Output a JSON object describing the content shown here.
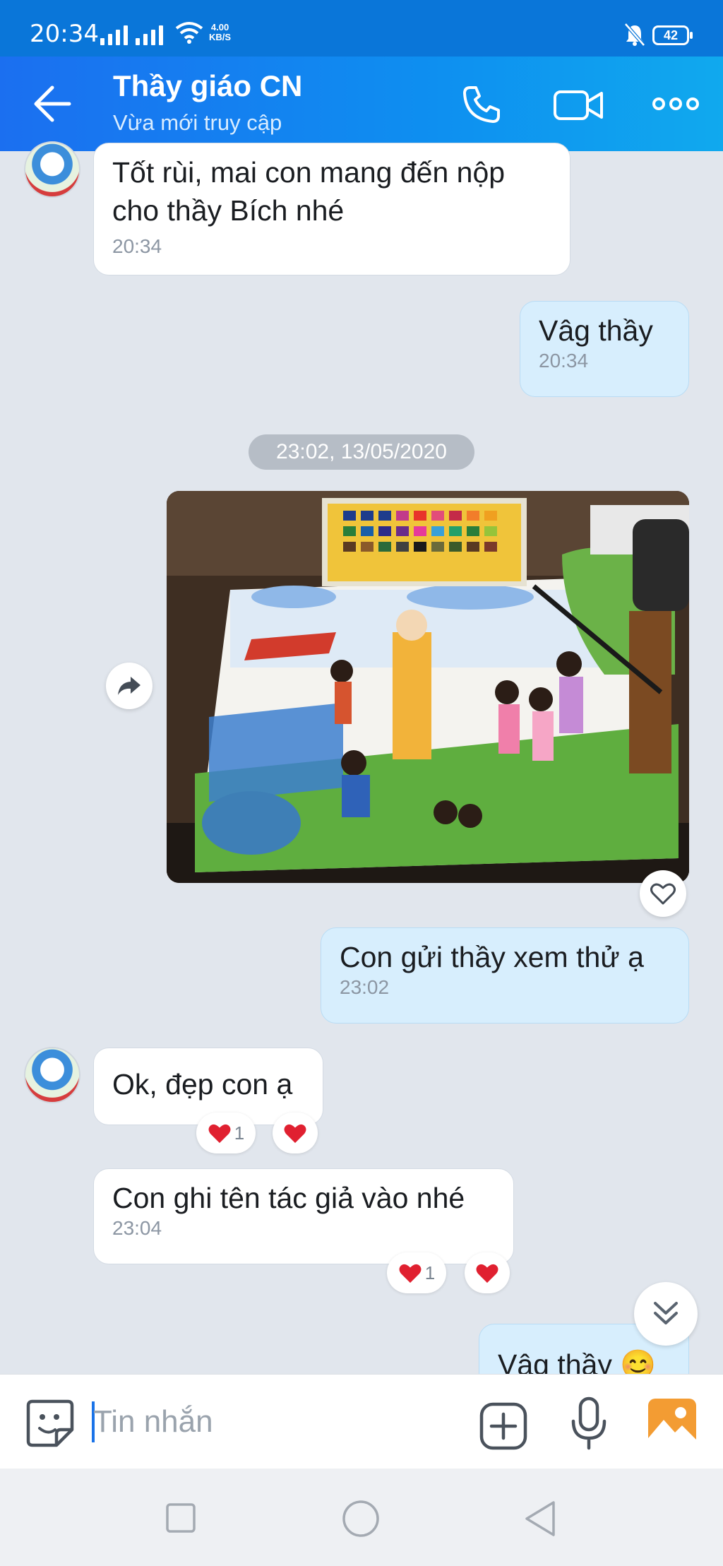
{
  "status_bar": {
    "time": "20:34",
    "net_speed_value": "4.00",
    "net_speed_unit": "KB/S",
    "battery": "42"
  },
  "header": {
    "title": "Thầy giáo CN",
    "subtitle": "Vừa mới truy cập"
  },
  "messages": [
    {
      "dir": "in",
      "text": "Tốt rùi, mai con mang đến nộp cho thầy Bích nhé",
      "time": "20:34"
    },
    {
      "dir": "out",
      "text": "Vâg thầy",
      "time": "20:34"
    },
    {
      "type": "date_separator",
      "text": "23:02, 13/05/2020"
    },
    {
      "dir": "out",
      "type": "image",
      "image_description": "children's watercolor drawing with paint palette"
    },
    {
      "dir": "out",
      "text": "Con gửi thầy xem thử ạ",
      "time": "23:02"
    },
    {
      "dir": "in",
      "text": "Ok, đẹp con ạ",
      "reaction_count": "1"
    },
    {
      "dir": "in",
      "text": "Con ghi tên tác giả vào nhé",
      "time": "23:04",
      "reaction_count": "1"
    },
    {
      "dir": "out",
      "text": "Vâg thầy 😊"
    }
  ],
  "composer": {
    "placeholder": "Tin nhắn"
  },
  "icons": {
    "back": "back-arrow-icon",
    "call": "phone-icon",
    "video": "video-camera-icon",
    "more": "more-icon",
    "forward": "forward-icon",
    "like": "heart-outline-icon",
    "scroll": "double-chevron-down-icon",
    "sticker": "sticker-icon",
    "add": "plus-icon",
    "mic": "microphone-icon",
    "gallery": "image-gallery-icon"
  },
  "colors": {
    "header": "#0e8ff0",
    "out_bubble": "#d7eefd",
    "chat_bg": "#e1e6ed",
    "heart": "#e02030",
    "gallery": "#f39c33"
  }
}
